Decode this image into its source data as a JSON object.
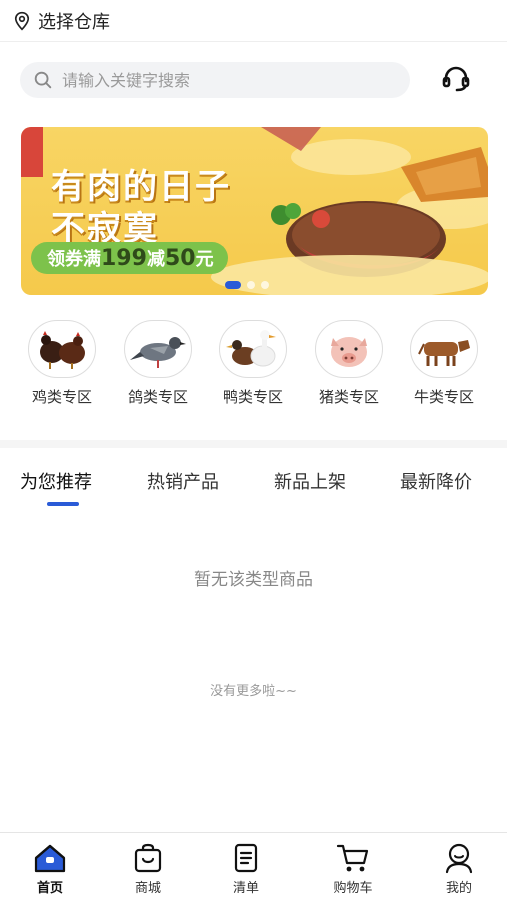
{
  "header": {
    "title": "选择仓库",
    "icon": "location-pin-icon"
  },
  "search": {
    "placeholder": "请输入关键字搜索",
    "icon": "search-icon",
    "service_icon": "customer-service-headset-icon"
  },
  "banner": {
    "line1": "有肉的日子",
    "line2": "不寂寞",
    "coupon_prefix": "领券满",
    "coupon_threshold": "199",
    "coupon_middle": "减",
    "coupon_amount": "50",
    "coupon_suffix": "元",
    "dots": 3,
    "active_dot": 0
  },
  "categories": [
    {
      "label": "鸡类专区",
      "icon": "chicken-icon"
    },
    {
      "label": "鸽类专区",
      "icon": "pigeon-icon"
    },
    {
      "label": "鸭类专区",
      "icon": "duck-icon"
    },
    {
      "label": "猪类专区",
      "icon": "pig-icon"
    },
    {
      "label": "牛类专区",
      "icon": "cow-icon"
    }
  ],
  "tabs": [
    {
      "label": "为您推荐",
      "active": true
    },
    {
      "label": "热销产品",
      "active": false
    },
    {
      "label": "新品上架",
      "active": false
    },
    {
      "label": "最新降价",
      "active": false
    }
  ],
  "empty_text": "暂无该类型商品",
  "no_more_text": "没有更多啦~~",
  "tabbar": [
    {
      "label": "首页",
      "icon": "home-icon",
      "active": true
    },
    {
      "label": "商城",
      "icon": "shopping-bag-icon",
      "active": false
    },
    {
      "label": "清单",
      "icon": "list-clipboard-icon",
      "active": false
    },
    {
      "label": "购物车",
      "icon": "cart-icon",
      "active": false
    },
    {
      "label": "我的",
      "icon": "user-icon",
      "active": false
    }
  ],
  "colors": {
    "accent": "#2a5bd7",
    "banner_bg": "#f5c94b",
    "coupon_bg": "#7dc24b"
  }
}
